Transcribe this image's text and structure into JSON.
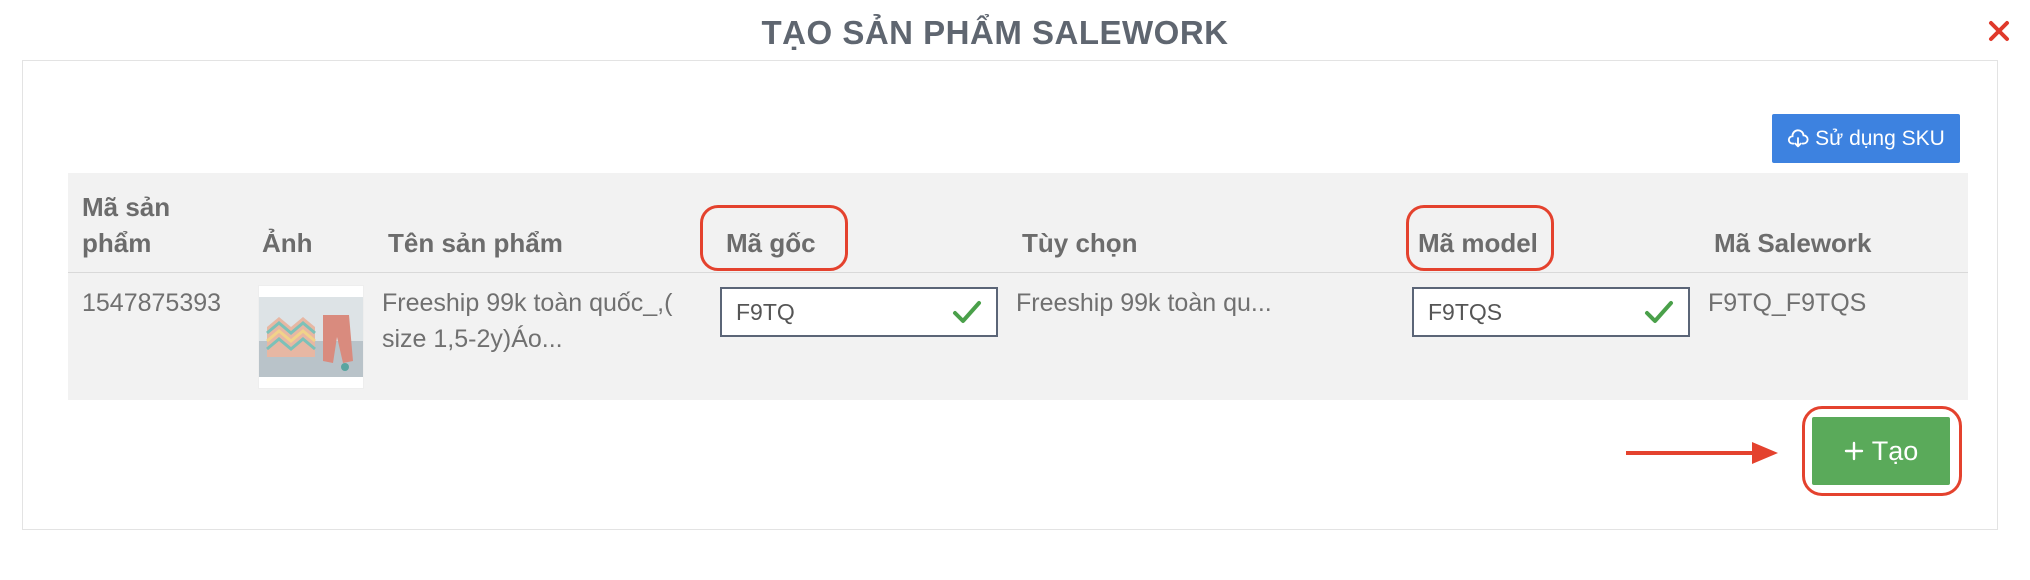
{
  "modal": {
    "title": "TẠO SẢN PHẨM SALEWORK",
    "close_icon": "close-icon"
  },
  "toolbar": {
    "sku_button_label": "Sử dụng SKU",
    "sku_icon": "cloud-download-icon"
  },
  "table": {
    "headers": {
      "product_code_line1": "Mã sản",
      "product_code_line2": "phẩm",
      "image": "Ảnh",
      "product_name": "Tên sản phẩm",
      "base_code": "Mã gốc",
      "option": "Tùy chọn",
      "model_code": "Mã model",
      "salework_code": "Mã Salework"
    },
    "rows": [
      {
        "product_code": "1547875393",
        "product_name_line1": "Freeship 99k toàn quốc_,(",
        "product_name_line2": "size 1,5-2y)Áo...",
        "base_code": "F9TQ",
        "option": "Freeship 99k toàn qu...",
        "model_code": "F9TQS",
        "salework_code": "F9TQ_F9TQS"
      }
    ]
  },
  "actions": {
    "create_label": "Tạo",
    "create_icon": "plus-icon"
  },
  "colors": {
    "primary_blue": "#3d82e0",
    "success_green": "#5aaa5a",
    "highlight_red": "#e4422e",
    "close_red": "#e0392b",
    "check_green": "#4aa04a"
  }
}
